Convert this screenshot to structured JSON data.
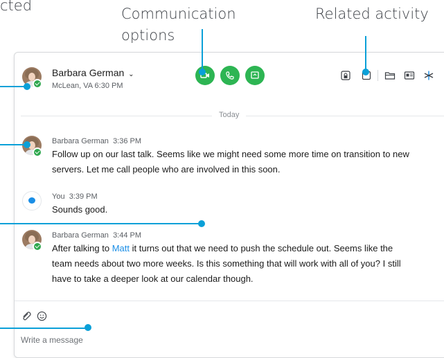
{
  "callouts": {
    "top_left_partial": "cted",
    "communication_line1": "Communication",
    "communication_line2": "options",
    "related_activity": "Related activity"
  },
  "header": {
    "contact_name": "Barbara German",
    "location_time": "McLean, VA 6:30 PM",
    "comm_buttons": [
      "video-call",
      "audio-call",
      "screen-share"
    ],
    "tools": [
      "room-lock-icon",
      "whiteboard-icon",
      "files-icon",
      "contact-card-icon",
      "apps-icon"
    ]
  },
  "timeline": {
    "divider": "Today"
  },
  "messages": [
    {
      "author": "Barbara German",
      "time": "3:36 PM",
      "line1": "Follow up on our last talk. Seems like we might need some more time on transition to new",
      "line2": "servers. Let me call people who are involved in this soon."
    },
    {
      "author": "You",
      "time": "3:39 PM",
      "line1": "Sounds good."
    },
    {
      "author": "Barbara German",
      "time": "3:44 PM",
      "line1_before": "After talking to ",
      "mention": "Matt",
      "line1_after": " it turns out that we need to push the schedule out. Seems like the",
      "line2": "team needs about two more weeks. Is this something that will work with all of you? I still",
      "line3": "have to take a deeper look at our calendar though."
    }
  ],
  "composer": {
    "placeholder": "Write a message"
  },
  "colors": {
    "callout_line": "#0aa0d8",
    "call_green": "#2db553",
    "presence_green": "#2fa84f",
    "mention_blue": "#1a8ee6"
  }
}
